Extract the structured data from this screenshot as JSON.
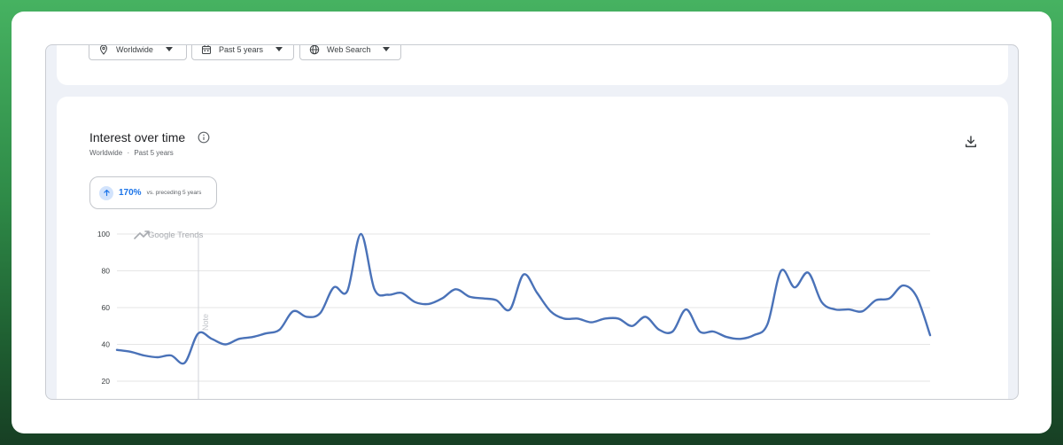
{
  "filters": {
    "location": "Worldwide",
    "timeframe": "Past 5 years",
    "property": "Web Search"
  },
  "panel": {
    "title": "Interest over time",
    "subtitle_location": "Worldwide",
    "subtitle_separator": "·",
    "subtitle_timeframe": "Past 5 years"
  },
  "change": {
    "percent": "170%",
    "label": "vs. preceding 5 years"
  },
  "watermark": "Google Trends",
  "note_label": "Note",
  "icons": {
    "location": "location-pin-icon",
    "timeframe": "calendar-icon",
    "property": "globe-icon",
    "info": "info-icon",
    "download": "download-icon",
    "trend_up": "arrow-up-icon"
  },
  "colors": {
    "line": "#4a72b8",
    "accent": "#1a73e8",
    "grid": "#e6e6e6"
  },
  "chart_data": {
    "type": "line",
    "y_ticks": [
      20,
      40,
      60,
      80,
      100
    ],
    "ylim": [
      14,
      100
    ],
    "series": [
      {
        "values": [
          37,
          36,
          34,
          33,
          34,
          30,
          46,
          43,
          40,
          43,
          44,
          46,
          48,
          58,
          55,
          57,
          71,
          69,
          100,
          70,
          67,
          68,
          63,
          62,
          65,
          70,
          66,
          65,
          64,
          59,
          78,
          68,
          58,
          54,
          54,
          52,
          54,
          54,
          50,
          55,
          48,
          47,
          59,
          47,
          47,
          44,
          43,
          45,
          51,
          80,
          71,
          79,
          63,
          59,
          59,
          58,
          64,
          65,
          72,
          66,
          45
        ]
      }
    ]
  }
}
